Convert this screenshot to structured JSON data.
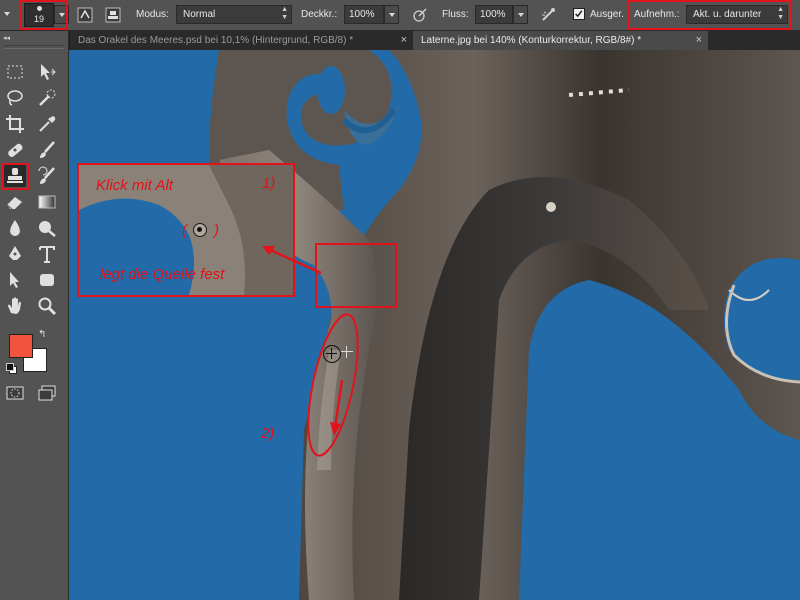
{
  "options_bar": {
    "brush_size": "19",
    "mode_label": "Modus:",
    "mode_value": "Normal",
    "opacity_label": "Deckkr.:",
    "opacity_value": "100%",
    "flow_label": "Fluss:",
    "flow_value": "100%",
    "aligned_label": "Ausger.",
    "sample_label": "Aufnehm.:",
    "sample_value": "Akt. u. darunter"
  },
  "tabs": [
    {
      "label": "Das Orakel des Meeres.psd bei 10,1% (Hintergrund, RGB/8) *"
    },
    {
      "label": "Laterne.jpg bei 140% (Konturkorrektur, RGB/8#) *"
    }
  ],
  "annotations": {
    "step1": "1)",
    "click_alt": "Klick mit Alt",
    "paren_open": "(",
    "paren_close": ")",
    "set_source": "legt die Quelle fest",
    "step2": "2)"
  },
  "colors": {
    "foreground": "#f0543c",
    "background": "#ffffff",
    "annotation_red": "#e0141a",
    "canvas_blue": "#236ba8"
  }
}
